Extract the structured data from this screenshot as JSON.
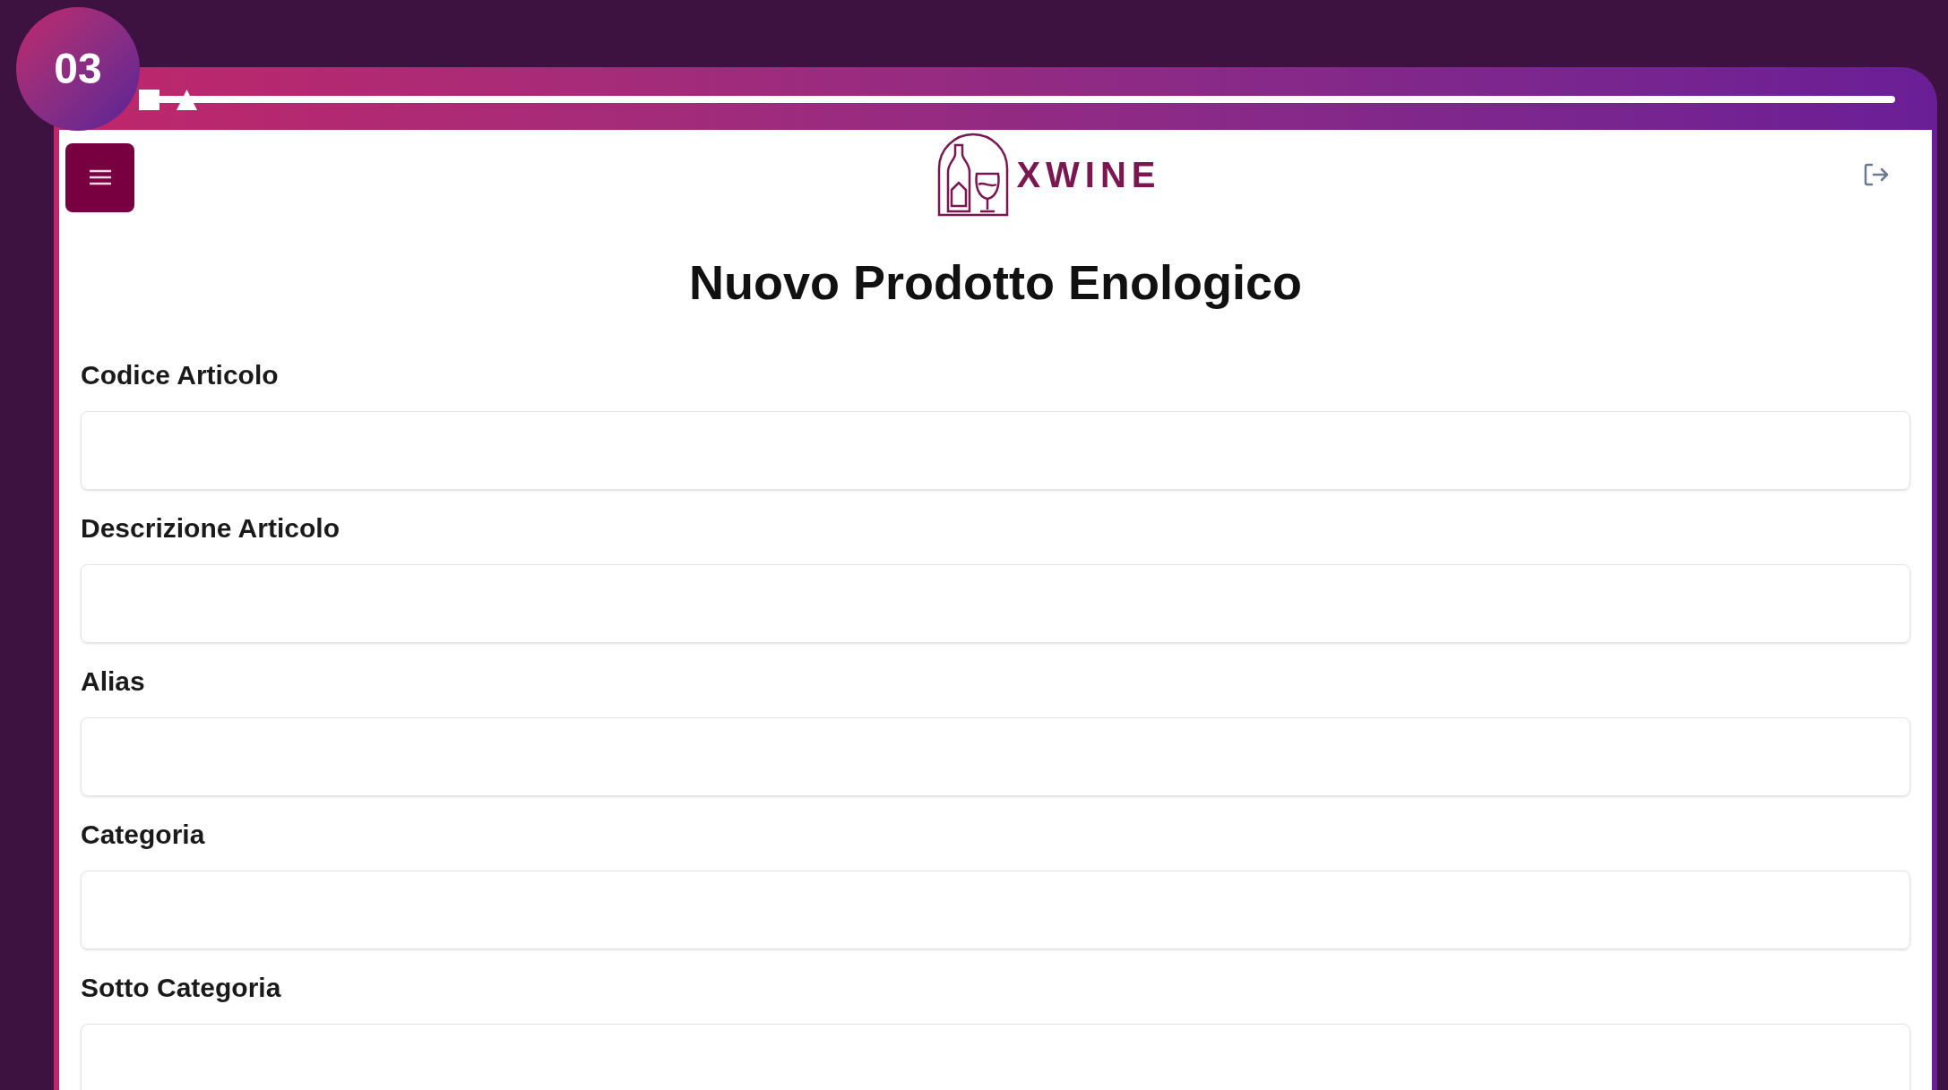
{
  "badge": "03",
  "header": {
    "logo_text": "XWINE"
  },
  "title": "Nuovo Prodotto Enologico",
  "fields": [
    {
      "label": "Codice Articolo"
    },
    {
      "label": "Descrizione Articolo"
    },
    {
      "label": "Alias"
    },
    {
      "label": "Categoria"
    },
    {
      "label": "Sotto Categoria"
    }
  ]
}
